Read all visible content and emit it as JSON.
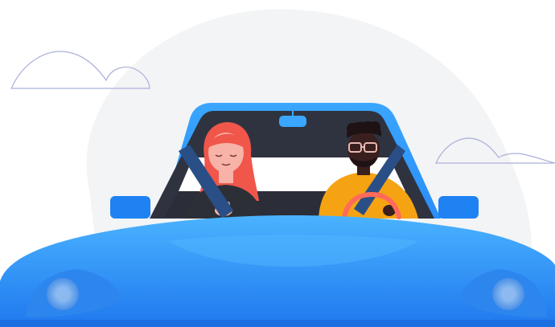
{
  "scene": {
    "background": "#ffffff",
    "blob_color": "#f3f4f6",
    "cloud_stroke": "#aab0d8",
    "car_body_light": "#4ab3ff",
    "car_body_dark": "#1f7ff0",
    "windshield_dark": "#2f3340",
    "seatbelt": "#2a4f86",
    "passenger_hair": "#f0564a",
    "passenger_skin": "#f7b3a8",
    "passenger_shirt": "#2d2f36",
    "driver_skin": "#3a1f1f",
    "driver_shirt": "#f5a313",
    "steering_wheel": "#ff6b5a",
    "headlight": "#6aa8ef"
  }
}
